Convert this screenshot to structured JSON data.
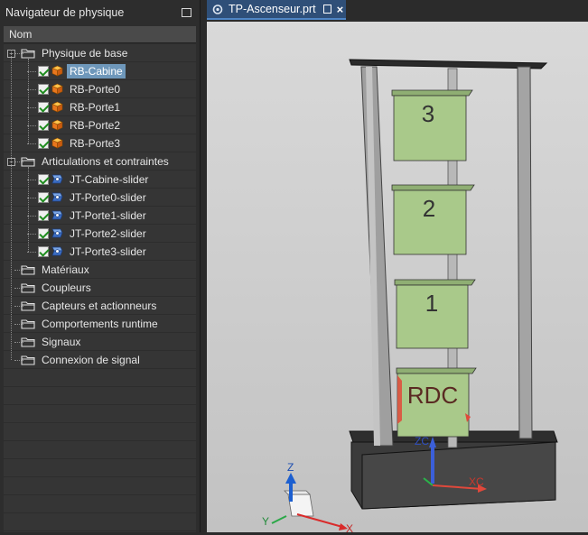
{
  "navigator": {
    "title": "Navigateur de physique",
    "column_header": "Nom",
    "tree": [
      {
        "label": "Physique de base",
        "type": "folder",
        "expanded": true,
        "children": [
          {
            "label": "RB-Cabine",
            "type": "rigid-body",
            "checked": true,
            "selected": true
          },
          {
            "label": "RB-Porte0",
            "type": "rigid-body",
            "checked": true
          },
          {
            "label": "RB-Porte1",
            "type": "rigid-body",
            "checked": true
          },
          {
            "label": "RB-Porte2",
            "type": "rigid-body",
            "checked": true
          },
          {
            "label": "RB-Porte3",
            "type": "rigid-body",
            "checked": true
          }
        ]
      },
      {
        "label": "Articulations et contraintes",
        "type": "folder",
        "expanded": true,
        "children": [
          {
            "label": "JT-Cabine-slider",
            "type": "joint",
            "checked": true
          },
          {
            "label": "JT-Porte0-slider",
            "type": "joint",
            "checked": true
          },
          {
            "label": "JT-Porte1-slider",
            "type": "joint",
            "checked": true
          },
          {
            "label": "JT-Porte2-slider",
            "type": "joint",
            "checked": true
          },
          {
            "label": "JT-Porte3-slider",
            "type": "joint",
            "checked": true
          }
        ]
      },
      {
        "label": "Matériaux",
        "type": "folder"
      },
      {
        "label": "Coupleurs",
        "type": "folder"
      },
      {
        "label": "Capteurs et actionneurs",
        "type": "folder"
      },
      {
        "label": "Comportements runtime",
        "type": "folder"
      },
      {
        "label": "Signaux",
        "type": "folder"
      },
      {
        "label": "Connexion de signal",
        "type": "folder"
      }
    ]
  },
  "tab": {
    "label": "TP-Ascenseur.prt",
    "close_glyph": "×"
  },
  "viewport": {
    "floor_labels": [
      "3",
      "2",
      "1",
      "RDC"
    ],
    "work_axes": {
      "z": "ZC",
      "x": "XC"
    },
    "abs_axes": {
      "z": "Z",
      "x": "X",
      "y": "Y"
    }
  },
  "colors": {
    "selection": "#6e97ba",
    "tab_active": "#2f4f78",
    "door_green": "#a9c98a",
    "frame_gray": "#a9a9a9",
    "base_dark": "#3a3a3a"
  }
}
